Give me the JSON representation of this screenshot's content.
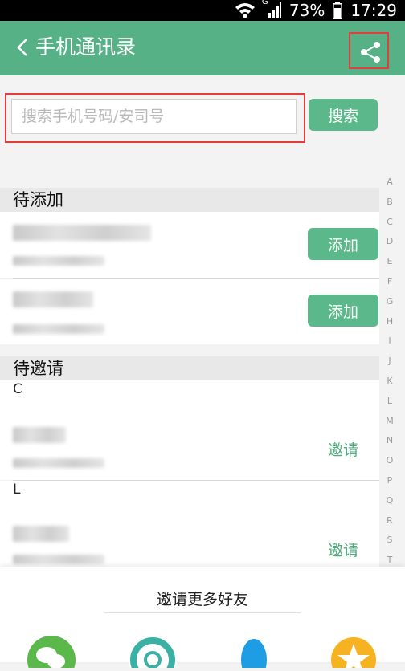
{
  "status_bar": {
    "signal_label": "G",
    "battery": "73%",
    "time": "17:29"
  },
  "app_bar": {
    "title": "手机通讯录"
  },
  "search": {
    "placeholder": "搜索手机号码/安司号",
    "button_label": "搜索"
  },
  "sections": [
    {
      "title": "待添加",
      "action_label": "添加"
    },
    {
      "title": "待邀请",
      "action_label": "邀请"
    }
  ],
  "groups": [
    "C",
    "L"
  ],
  "index_letters": [
    "A",
    "B",
    "C",
    "D",
    "E",
    "F",
    "G",
    "H",
    "I",
    "J",
    "K",
    "L",
    "M",
    "N",
    "O",
    "P",
    "Q",
    "R",
    "S",
    "T"
  ],
  "bottom": {
    "invite_more": "邀请更多好友"
  },
  "colors": {
    "primary": "#56b187",
    "button": "#5bb88a",
    "highlight_outline": "#e33e3e"
  },
  "icons": [
    "wifi-icon",
    "cell-signal-icon",
    "battery-icon",
    "back-chevron-icon",
    "share-icon",
    "wechat-icon",
    "moments-icon",
    "qq-icon",
    "qzone-icon"
  ]
}
